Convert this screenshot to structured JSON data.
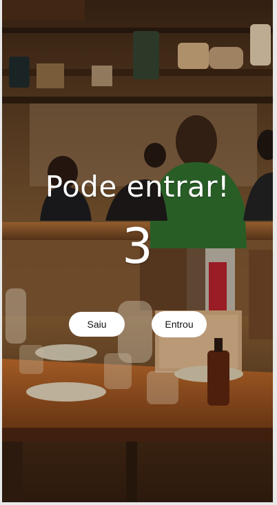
{
  "screen": {
    "title": "Pode entrar!",
    "counter": "3"
  },
  "actions": {
    "exit_label": "Saiu",
    "enter_label": "Entrou"
  },
  "background": {
    "description_icon": "restaurant-photo"
  }
}
